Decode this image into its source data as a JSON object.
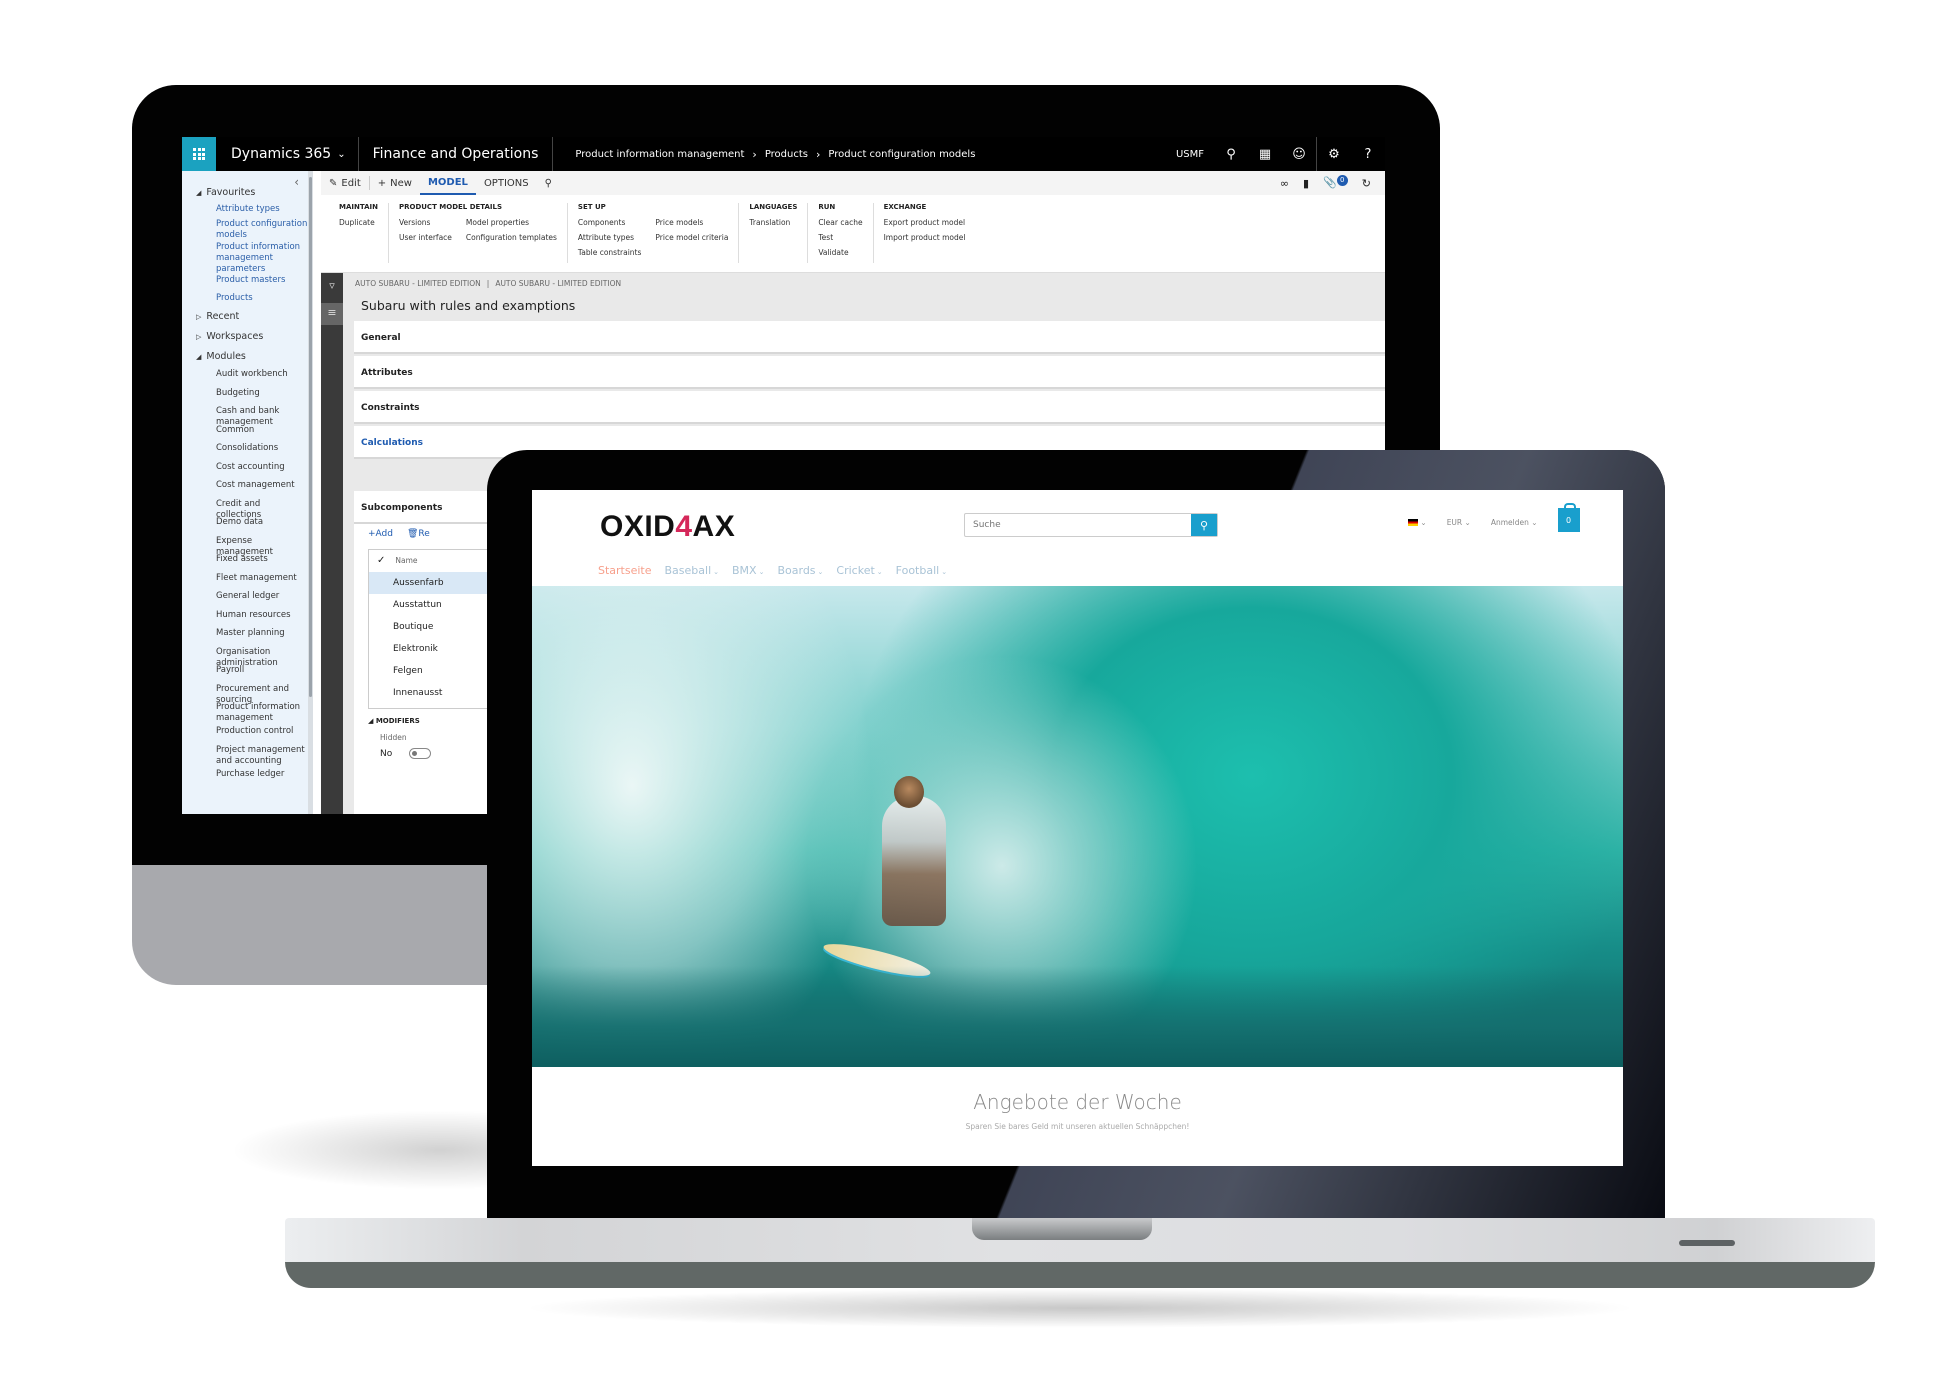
{
  "dynamics": {
    "app_name": "Dynamics 365",
    "module_name": "Finance and Operations",
    "breadcrumb": [
      "Product information management",
      "Products",
      "Product configuration models"
    ],
    "company": "USMF",
    "nav_icons": [
      "search-icon",
      "message-icon",
      "smiley-icon",
      "gear-icon",
      "help-icon"
    ],
    "help_glyph": "?",
    "sidebar": {
      "favourites_label": "Favourites",
      "favourites": [
        "Attribute types",
        "Product configuration models",
        "Product information management parameters",
        "Product masters",
        "Products"
      ],
      "recent_label": "Recent",
      "workspaces_label": "Workspaces",
      "modules_label": "Modules",
      "modules": [
        "Audit workbench",
        "Budgeting",
        "Cash and bank management",
        "Common",
        "Consolidations",
        "Cost accounting",
        "Cost management",
        "Credit and collections",
        "Demo data",
        "Expense management",
        "Fixed assets",
        "Fleet management",
        "General ledger",
        "Human resources",
        "Master planning",
        "Organisation administration",
        "Payroll",
        "Procurement and sourcing",
        "Product information management",
        "Production control",
        "Project management and accounting",
        "Purchase ledger"
      ]
    },
    "toolbar": {
      "edit": "Edit",
      "new": "New",
      "tabs": [
        "MODEL",
        "OPTIONS"
      ],
      "active_tab": "MODEL",
      "notification_count": "0"
    },
    "ribbon": {
      "groups": [
        {
          "title": "MAINTAIN",
          "columns": [
            [
              "Duplicate"
            ]
          ]
        },
        {
          "title": "PRODUCT MODEL DETAILS",
          "columns": [
            [
              "Versions",
              "User interface"
            ],
            [
              "Model properties",
              "Configuration templates"
            ]
          ]
        },
        {
          "title": "SET UP",
          "columns": [
            [
              "Components",
              "Attribute types",
              "Table constraints"
            ],
            [
              "Price models",
              "Price model criteria"
            ]
          ]
        },
        {
          "title": "LANGUAGES",
          "columns": [
            [
              "Translation"
            ]
          ]
        },
        {
          "title": "RUN",
          "columns": [
            [
              "Clear cache",
              "Test",
              "Validate"
            ]
          ]
        },
        {
          "title": "EXCHANGE",
          "columns": [
            [
              "Export product model",
              "Import product model"
            ]
          ]
        }
      ]
    },
    "form": {
      "caption_left": "AUTO SUBARU - LIMITED EDITION",
      "caption_right": "AUTO SUBARU - LIMITED EDITION",
      "title": "Subaru with rules and examptions",
      "fasttabs": [
        "General",
        "Attributes",
        "Constraints",
        "Calculations",
        "Subcomponents"
      ],
      "subcomponents": {
        "add_label": "Add",
        "remove_label": "Re",
        "column_name": "Name",
        "rows": [
          "Aussenfarb",
          "Ausstattun",
          "Boutique",
          "Elektronik",
          "Felgen",
          "Innenausst"
        ],
        "selected_row": "Aussenfarb",
        "modifiers_label": "MODIFIERS",
        "hidden_label": "Hidden",
        "hidden_value": "No"
      }
    }
  },
  "shop": {
    "logo_prefix": "OXID",
    "logo_four": "4",
    "logo_suffix": "AX",
    "logo_accent": "#d5285a",
    "search_placeholder": "Suche",
    "currency": "EUR",
    "login": "Anmelden",
    "cart_count": "0",
    "brand_color": "#199fcd",
    "nav": [
      {
        "label": "Startseite",
        "active": true,
        "dropdown": false
      },
      {
        "label": "Baseball",
        "active": false,
        "dropdown": true
      },
      {
        "label": "BMX",
        "active": false,
        "dropdown": true
      },
      {
        "label": "Boards",
        "active": false,
        "dropdown": true
      },
      {
        "label": "Cricket",
        "active": false,
        "dropdown": true
      },
      {
        "label": "Football",
        "active": false,
        "dropdown": true
      }
    ],
    "hero_alt": "Surfer riding inside a turquoise wave barrel",
    "deals_title": "Angebote der Woche",
    "deals_subtitle": "Sparen Sie bares Geld mit unseren aktuellen Schnäppchen!"
  }
}
